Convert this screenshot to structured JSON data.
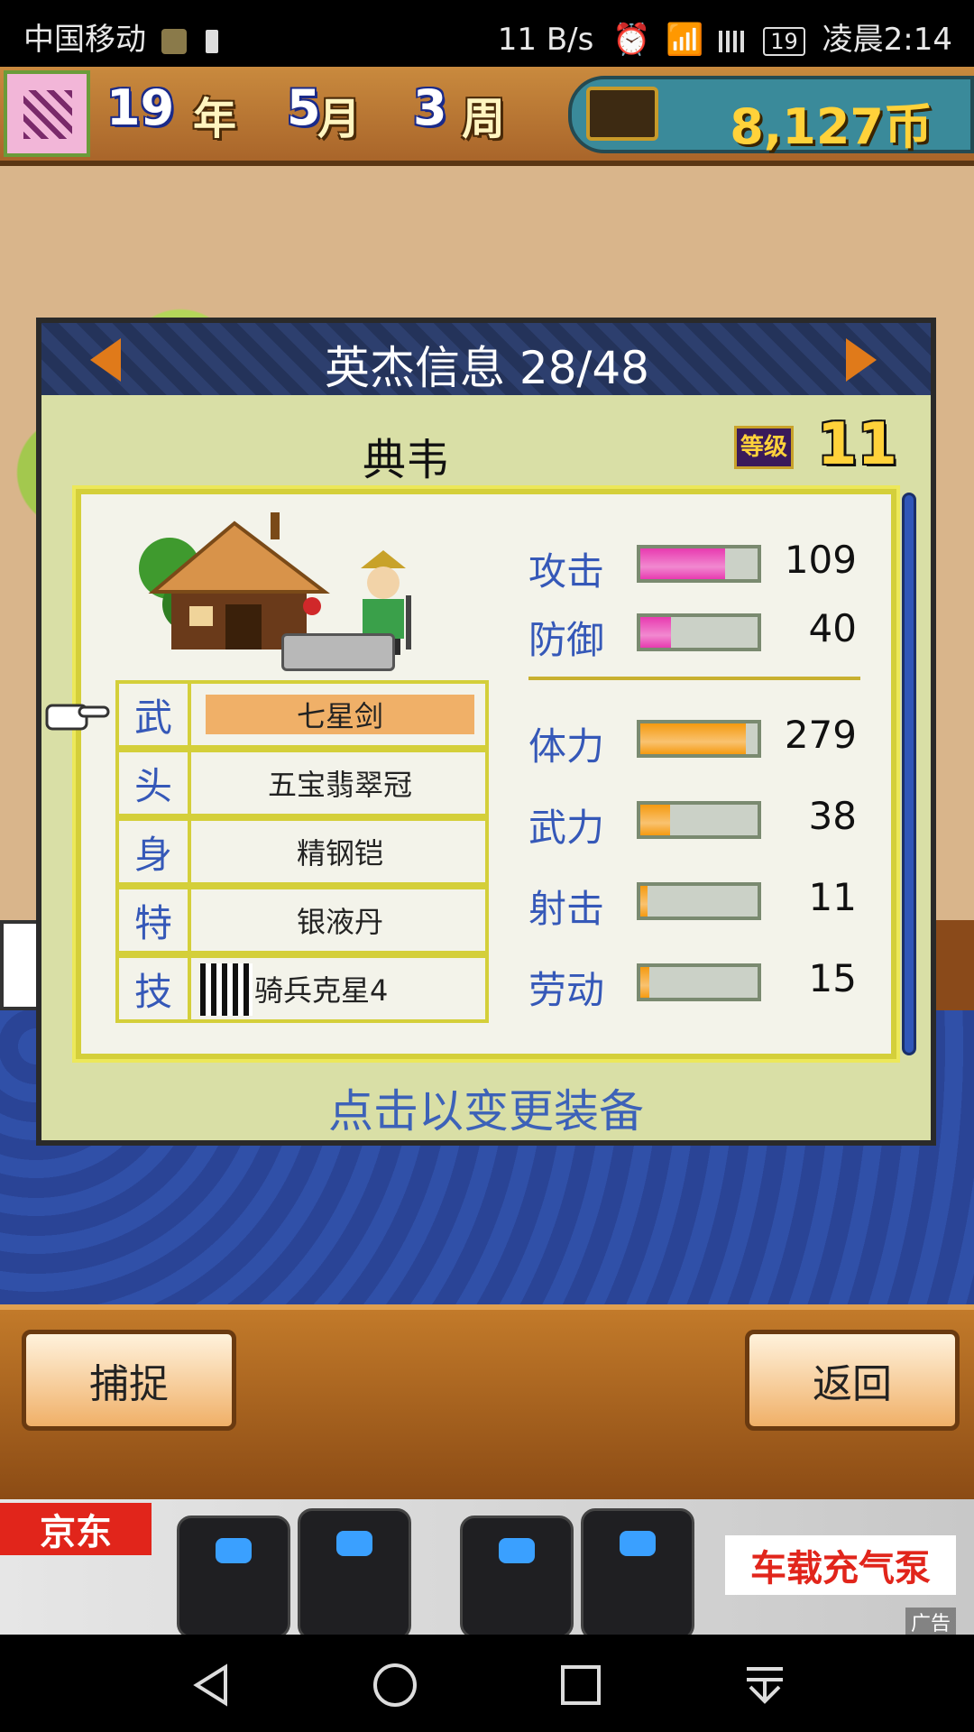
{
  "status_bar": {
    "carrier": "中国移动",
    "speed": "11 B/s",
    "battery": "19",
    "time": "凌晨2:14"
  },
  "top_bar": {
    "year_num": "19",
    "year_unit": "年",
    "month_num": "5",
    "month_unit": "月",
    "week_num": "3",
    "week_unit": "周",
    "money": "8,127币"
  },
  "dialog": {
    "title": "英杰信息 28/48",
    "hero_name": "典韦",
    "level_label": "等级",
    "level_value": "11",
    "hint": "点击以变更装备"
  },
  "equipment": [
    {
      "slot": "武",
      "item": "七星剑",
      "selected": true
    },
    {
      "slot": "头",
      "item": "五宝翡翠冠",
      "selected": false
    },
    {
      "slot": "身",
      "item": "精钢铠",
      "selected": false
    },
    {
      "slot": "特",
      "item": "银液丹",
      "selected": false
    },
    {
      "slot": "技",
      "item": "骑兵克星4",
      "selected": false
    }
  ],
  "stats": [
    {
      "label": "攻击",
      "value": "109",
      "fill": 0.72,
      "color": "#e83ab0"
    },
    {
      "label": "防御",
      "value": "40",
      "fill": 0.26,
      "color": "#e83ab0"
    },
    {
      "label": "体力",
      "value": "279",
      "fill": 0.9,
      "color": "#f59a10"
    },
    {
      "label": "武力",
      "value": "38",
      "fill": 0.25,
      "color": "#f59a10"
    },
    {
      "label": "射击",
      "value": "11",
      "fill": 0.06,
      "color": "#f59a10"
    },
    {
      "label": "劳动",
      "value": "15",
      "fill": 0.08,
      "color": "#f59a10"
    }
  ],
  "buttons": {
    "capture": "捕捉",
    "back": "返回"
  },
  "ad": {
    "brand": "京东",
    "product": "车载充气泵",
    "label": "广告"
  },
  "icons": {
    "alarm": "alarm-icon",
    "wifi": "wifi-icon",
    "signal": "signal-icon",
    "battery": "battery-icon",
    "chest": "treasure-chest-icon",
    "pointer": "hand-pointer-icon",
    "back": "nav-back-icon",
    "home": "nav-home-icon",
    "recents": "nav-recents-icon",
    "notifications": "nav-notification-icon"
  },
  "colors": {
    "stat_label": "#3558b8",
    "level_gold": "#ffd23a",
    "attack_bar": "#e83ab0",
    "stamina_bar": "#f59a10"
  }
}
